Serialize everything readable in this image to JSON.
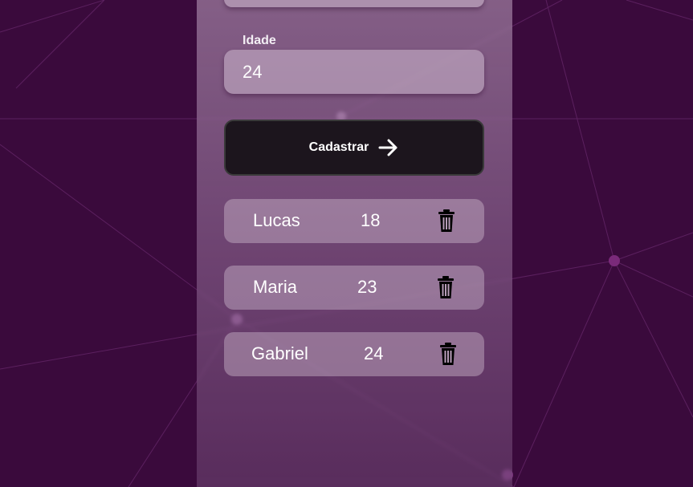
{
  "form": {
    "age_label": "Idade",
    "age_value": "24",
    "submit_label": "Cadastrar"
  },
  "users": [
    {
      "name": "Lucas",
      "age": "18"
    },
    {
      "name": "Maria",
      "age": "23"
    },
    {
      "name": "Gabriel",
      "age": "24"
    }
  ],
  "icons": {
    "submit": "arrow-right-icon",
    "delete": "trash-icon"
  },
  "colors": {
    "background": "#3a0a3c",
    "button": "#1c151d"
  }
}
